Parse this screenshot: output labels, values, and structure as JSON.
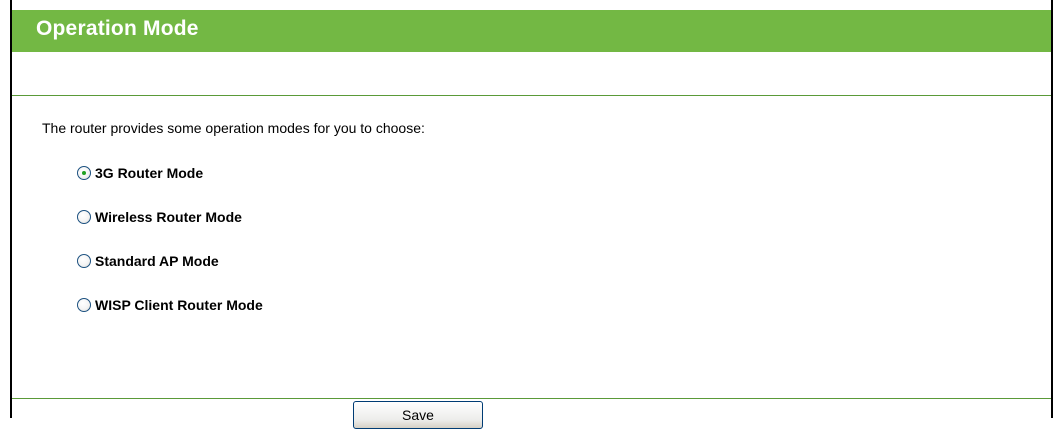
{
  "header": {
    "title": "Operation Mode"
  },
  "main": {
    "intro": "The router provides some operation modes for you to choose:",
    "modes": [
      {
        "label": "3G Router Mode",
        "selected": true
      },
      {
        "label": "Wireless Router Mode",
        "selected": false
      },
      {
        "label": "Standard AP Mode",
        "selected": false
      },
      {
        "label": "WISP Client Router Mode",
        "selected": false
      }
    ]
  },
  "footer": {
    "save_label": "Save"
  },
  "colors": {
    "title_bar": "#73b844",
    "divider": "#5a9a38"
  }
}
